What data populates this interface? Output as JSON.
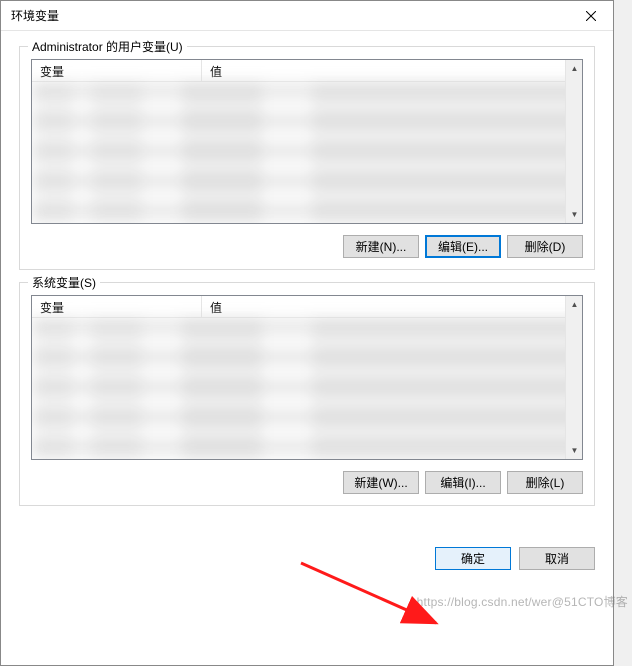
{
  "titlebar": {
    "title": "环境变量"
  },
  "user_vars": {
    "legend": "Administrator 的用户变量(U)",
    "col_var": "变量",
    "col_val": "值",
    "buttons": {
      "new": "新建(N)...",
      "edit": "编辑(E)...",
      "delete": "删除(D)"
    }
  },
  "system_vars": {
    "legend": "系统变量(S)",
    "col_var": "变量",
    "col_val": "值",
    "buttons": {
      "new": "新建(W)...",
      "edit": "编辑(I)...",
      "delete": "删除(L)"
    }
  },
  "dialog_buttons": {
    "ok": "确定",
    "cancel": "取消"
  },
  "watermark": "https://blog.csdn.net/wer@51CTO博客"
}
